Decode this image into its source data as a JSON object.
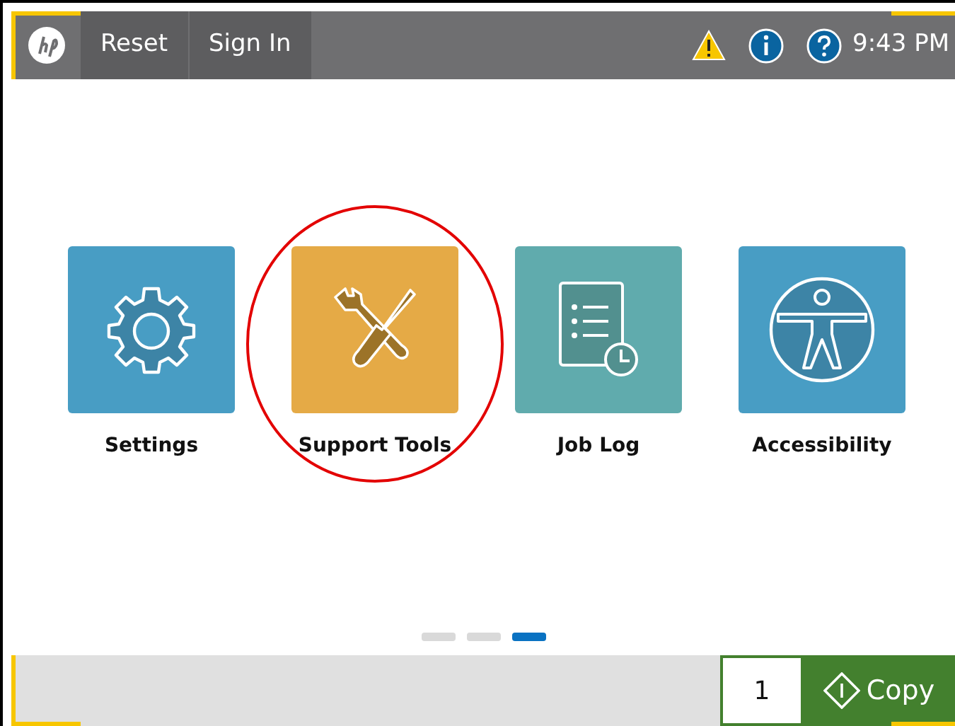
{
  "header": {
    "buttons": [
      "Reset",
      "Sign In"
    ],
    "status_icons": [
      {
        "kind": "warning"
      },
      {
        "kind": "info"
      },
      {
        "kind": "help"
      }
    ],
    "time": "9:43 PM"
  },
  "tiles": [
    {
      "label": "Settings",
      "kind": "gear",
      "color": "#489dc4",
      "highlighted": false
    },
    {
      "label": "Support Tools",
      "kind": "tools",
      "color": "#e5aa46",
      "highlighted": true
    },
    {
      "label": "Job Log",
      "kind": "joblog",
      "color": "#60abad",
      "highlighted": false
    },
    {
      "label": "Accessibility",
      "kind": "accessibility",
      "color": "#489dc4",
      "highlighted": false
    }
  ],
  "pages": [
    {
      "selected": false
    },
    {
      "selected": false
    },
    {
      "selected": true
    }
  ],
  "footer": {
    "copies": "1",
    "action": "Copy"
  }
}
